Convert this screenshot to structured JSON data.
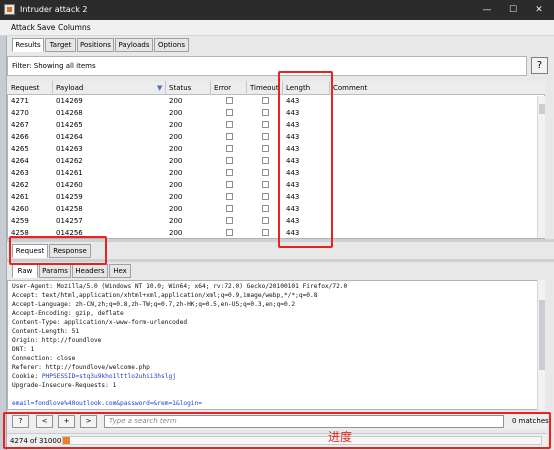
{
  "window": {
    "title": "Intruder attack 2",
    "minimize": "—",
    "maximize": "☐",
    "close": "✕"
  },
  "menu": [
    "Attack",
    "Save",
    "Columns"
  ],
  "main_tabs": [
    "Results",
    "Target",
    "Positions",
    "Payloads",
    "Options"
  ],
  "filter": {
    "text": "Filter: Showing all items",
    "help": "?"
  },
  "table": {
    "columns": [
      "Request",
      "Payload",
      "Status",
      "Error",
      "Timeout",
      "Length",
      "Comment"
    ],
    "sort_indicator": "▼",
    "rows": [
      {
        "request": "4271",
        "payload": "014269",
        "status": "200",
        "length": "443"
      },
      {
        "request": "4270",
        "payload": "014268",
        "status": "200",
        "length": "443"
      },
      {
        "request": "4267",
        "payload": "014265",
        "status": "200",
        "length": "443"
      },
      {
        "request": "4266",
        "payload": "014264",
        "status": "200",
        "length": "443"
      },
      {
        "request": "4265",
        "payload": "014263",
        "status": "200",
        "length": "443"
      },
      {
        "request": "4264",
        "payload": "014262",
        "status": "200",
        "length": "443"
      },
      {
        "request": "4263",
        "payload": "014261",
        "status": "200",
        "length": "443"
      },
      {
        "request": "4262",
        "payload": "014260",
        "status": "200",
        "length": "443"
      },
      {
        "request": "4261",
        "payload": "014259",
        "status": "200",
        "length": "443"
      },
      {
        "request": "4260",
        "payload": "014258",
        "status": "200",
        "length": "443"
      },
      {
        "request": "4259",
        "payload": "014257",
        "status": "200",
        "length": "443"
      },
      {
        "request": "4258",
        "payload": "014256",
        "status": "200",
        "length": "443"
      }
    ]
  },
  "req_tabs": [
    "Request",
    "Response"
  ],
  "view_tabs": [
    "Raw",
    "Params",
    "Headers",
    "Hex"
  ],
  "request_lines": [
    "User-Agent: Mozilla/5.0 (Windows NT 10.0; Win64; x64; rv:72.0) Gecko/20100101 Firefox/72.0",
    "Accept: text/html,application/xhtml+xml,application/xml;q=0.9,image/webp,*/*;q=0.8",
    "Accept-Language: zh-CN,zh;q=0.8,zh-TW;q=0.7,zh-HK;q=0.5,en-US;q=0.3,en;q=0.2",
    "Accept-Encoding: gzip, deflate",
    "Content-Type: application/x-www-form-urlencoded",
    "Content-Length: 51",
    "Origin: http://foundlove",
    "DNT: 1",
    "Connection: close",
    "Referer: http://foundlove/welcome.php",
    "Upgrade-Insecure-Requests: 1",
    ""
  ],
  "cookie_line": {
    "label": "Cookie: ",
    "value": "PHPSESSID=stq3u9kho1lttlo2uhii3hslgj"
  },
  "body_line": "email=fondlove%40outlook.com&password=&rem=1&login=",
  "search": {
    "buttons": [
      "?",
      "<",
      "+",
      ">"
    ],
    "placeholder": "Type a search term",
    "matches": "0 matches"
  },
  "progress": {
    "text": "4274 of 310001",
    "fraction": 0.0138
  },
  "annotation": {
    "label": "进度"
  },
  "colors": {
    "highlight": "#e8231f",
    "progress": "#e8812f"
  }
}
